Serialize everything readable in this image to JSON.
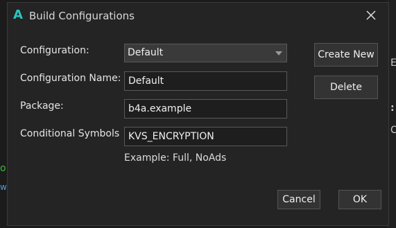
{
  "dialog": {
    "title": "Build Configurations",
    "logo_letter": "A"
  },
  "form": {
    "configuration_label": "Configuration:",
    "configuration_value": "Default",
    "name_label": "Configuration Name:",
    "name_value": "Default",
    "package_label": "Package:",
    "package_value": "b4a.example",
    "symbols_label": "Conditional Symbols",
    "symbols_value": "KVS_ENCRYPTION",
    "symbols_hint": "Example: Full, NoAds"
  },
  "buttons": {
    "create_new": "Create New",
    "delete": "Delete",
    "cancel": "Cancel",
    "ok": "OK"
  },
  "background": {
    "char_e": "E",
    "char_colon": ":",
    "char_c": "C",
    "char_o": "o",
    "char_w": "w"
  },
  "colors": {
    "accent_logo": "#2ec4c4",
    "dialog_bg": "#242424"
  }
}
